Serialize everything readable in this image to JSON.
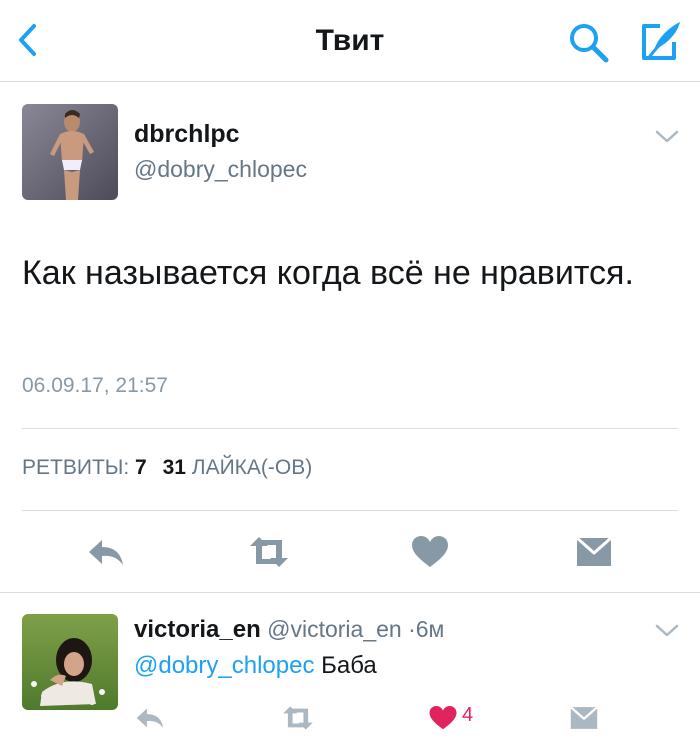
{
  "header": {
    "title": "Твит",
    "icons": {
      "back": "chevron-left-icon",
      "search": "search-icon",
      "compose": "compose-icon"
    },
    "accent_color": "#1da1f2"
  },
  "tweet": {
    "name": "dbrchlpc",
    "handle": "@dobry_chlopec",
    "text": "Как называется когда всё не нравится.",
    "timestamp": "06.09.17, 21:57",
    "retweets_label": "РЕТВИТЫ:",
    "retweets_count": "7",
    "likes_count": "31",
    "likes_label": "ЛАЙКА(-ОВ)",
    "actions": [
      "reply-icon",
      "retweet-icon",
      "heart-icon",
      "direct-message-icon"
    ]
  },
  "reply": {
    "name": "victoria_en",
    "handle": "@victoria_en",
    "separator": "·",
    "time": "6м",
    "mention": "@dobry_chlopec",
    "text": "Баба",
    "like_count": "4",
    "like_color": "#e0245e",
    "actions": [
      "reply-icon",
      "retweet-icon",
      "heart-icon",
      "direct-message-icon"
    ]
  }
}
